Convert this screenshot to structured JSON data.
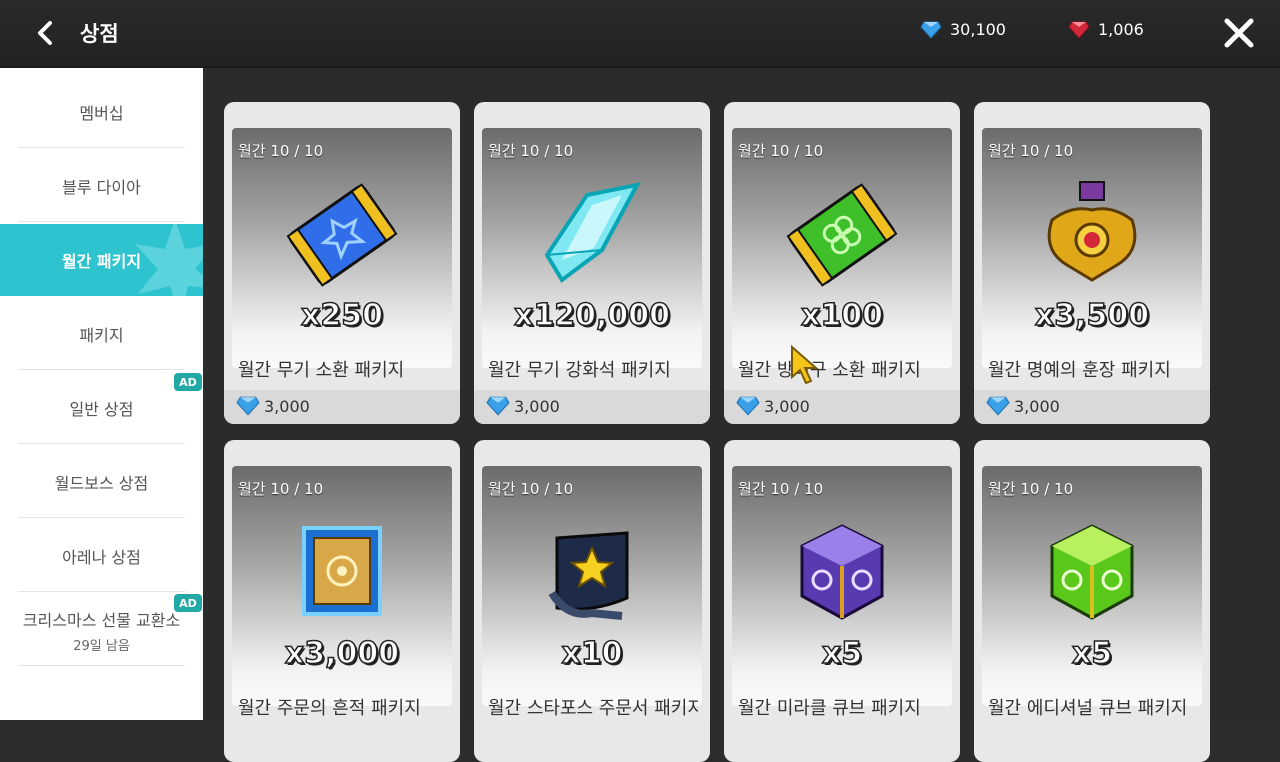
{
  "header": {
    "title": "상점",
    "blue_diamonds": "30,100",
    "red_diamonds": "1,006"
  },
  "sidebar": {
    "items": [
      {
        "label": "멤버십"
      },
      {
        "label": "블루 다이아"
      },
      {
        "label": "월간 패키지"
      },
      {
        "label": "패키지"
      },
      {
        "label": "일반 상점",
        "badge": "AD"
      },
      {
        "label": "월드보스 상점"
      },
      {
        "label": "아레나 상점"
      },
      {
        "label": "크리스마스 선물 교환소",
        "sub": "29일 남음",
        "badge": "AD"
      }
    ]
  },
  "products": [
    {
      "limit": "월간 10 / 10",
      "qty": "x250",
      "name": "월간 무기 소환 패키지",
      "price": "3,000",
      "icon": "blue-ticket-icon"
    },
    {
      "limit": "월간 10 / 10",
      "qty": "x120,000",
      "name": "월간 무기 강화석 패키지",
      "price": "3,000",
      "icon": "crystal-icon"
    },
    {
      "limit": "월간 10 / 10",
      "qty": "x100",
      "name": "월간 방어구 소환 패키지",
      "price": "3,000",
      "icon": "green-clover-ticket-icon"
    },
    {
      "limit": "월간 10 / 10",
      "qty": "x3,500",
      "name": "월간 명예의 훈장 패키지",
      "price": "3,000",
      "icon": "gold-medal-icon"
    },
    {
      "limit": "월간 10 / 10",
      "qty": "x3,000",
      "name": "월간 주문의 흔적 패키지",
      "icon": "trace-scroll-icon"
    },
    {
      "limit": "월간 10 / 10",
      "qty": "x10",
      "name": "월간 스타포스 주문서 패키지",
      "icon": "starforce-scroll-icon"
    },
    {
      "limit": "월간 10 / 10",
      "qty": "x5",
      "name": "월간 미라클 큐브 패키지",
      "icon": "purple-cube-icon"
    },
    {
      "limit": "월간 10 / 10",
      "qty": "x5",
      "name": "월간 에디셔널 큐브 패키지",
      "icon": "green-cube-icon"
    }
  ],
  "colors": {
    "active_tab": "#2ec4cf",
    "ad_badge": "#23a9a5",
    "blue_diamond": "#3aa0e8",
    "red_diamond": "#d2283a"
  }
}
